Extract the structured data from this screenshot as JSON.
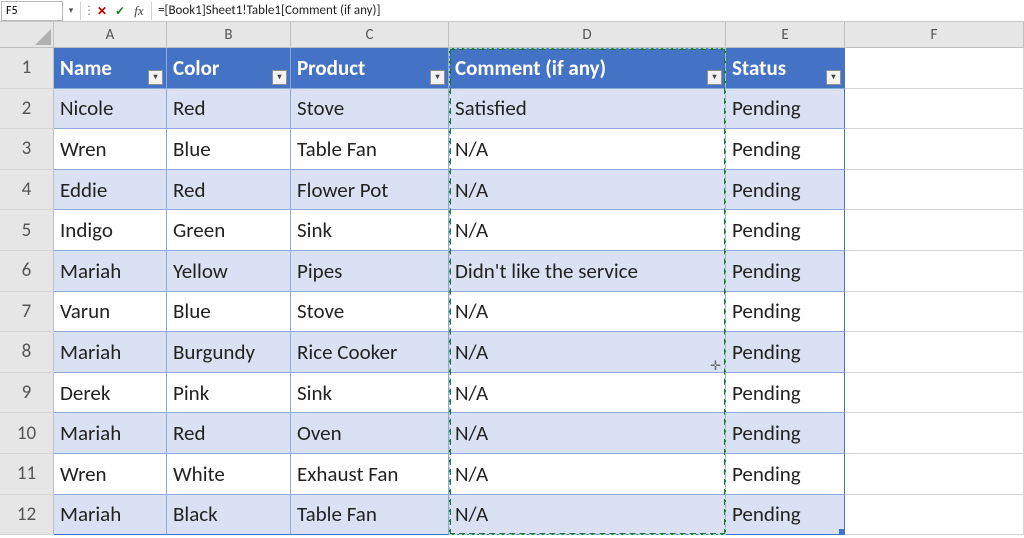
{
  "formula_bar": {
    "name_box": "F5",
    "cancel_glyph": "✕",
    "enter_glyph": "✓",
    "fx_glyph": "fx",
    "formula": "=[Book1]Sheet1!Table1[Comment (if any)]"
  },
  "columns": [
    "A",
    "B",
    "C",
    "D",
    "E",
    "F"
  ],
  "row_numbers": [
    "1",
    "2",
    "3",
    "4",
    "5",
    "6",
    "7",
    "8",
    "9",
    "10",
    "11",
    "12"
  ],
  "table": {
    "headers": [
      "Name",
      "Color",
      "Product",
      "Comment (if any)",
      "Status"
    ],
    "rows": [
      [
        "Nicole",
        "Red",
        "Stove",
        "Satisfied",
        "Pending"
      ],
      [
        "Wren",
        "Blue",
        "Table Fan",
        "N/A",
        "Pending"
      ],
      [
        "Eddie",
        "Red",
        "Flower Pot",
        "N/A",
        "Pending"
      ],
      [
        "Indigo",
        "Green",
        "Sink",
        "N/A",
        "Pending"
      ],
      [
        "Mariah",
        "Yellow",
        "Pipes",
        "Didn't like the service",
        "Pending"
      ],
      [
        "Varun",
        "Blue",
        "Stove",
        "N/A",
        "Pending"
      ],
      [
        "Mariah",
        "Burgundy",
        "Rice Cooker",
        "N/A",
        "Pending"
      ],
      [
        "Derek",
        "Pink",
        "Sink",
        "N/A",
        "Pending"
      ],
      [
        "Mariah",
        "Red",
        "Oven",
        "N/A",
        "Pending"
      ],
      [
        "Wren",
        "White",
        "Exhaust Fan",
        "N/A",
        "Pending"
      ],
      [
        "Mariah",
        "Black",
        "Table Fan",
        "N/A",
        "Pending"
      ]
    ]
  },
  "filter_glyph": "▾",
  "dropdown_glyph": "▾",
  "dots_glyph": "⋮",
  "cursor_plus_glyph": "✛"
}
